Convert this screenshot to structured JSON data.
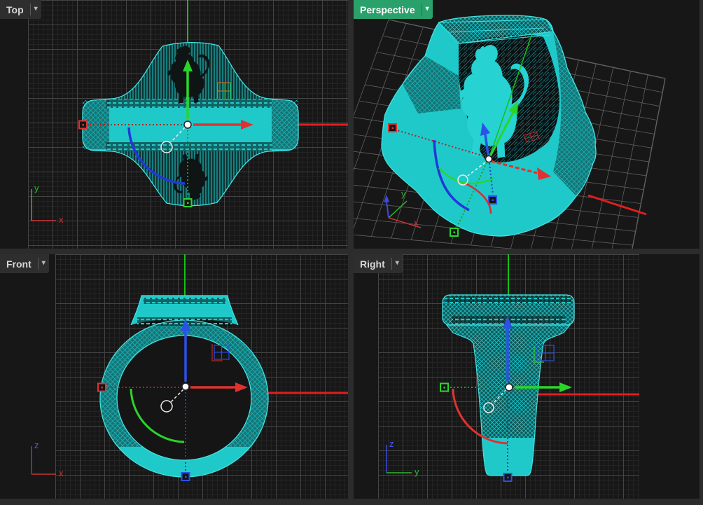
{
  "viewports": {
    "top": {
      "label": "Top",
      "active": false,
      "axis_gizmo": {
        "vertical_label": "y",
        "horizontal_label": "x"
      }
    },
    "perspective": {
      "label": "Perspective",
      "active": true,
      "axis_gizmo": {
        "vertical_label": "y",
        "horizontal_label": "x"
      }
    },
    "front": {
      "label": "Front",
      "active": false,
      "axis_gizmo": {
        "vertical_label": "z",
        "horizontal_label": "x"
      }
    },
    "right": {
      "label": "Right",
      "active": false,
      "axis_gizmo": {
        "vertical_label": "z",
        "horizontal_label": "y"
      }
    }
  },
  "chevron_glyph": "▾",
  "scene": {
    "model_name": "signet-ring-wireframe",
    "engraving": "lion-silhouette",
    "widgets": [
      "gumball-move-arrows",
      "gumball-rotate-arcs",
      "gumball-scale-handles",
      "gumball-plane-handle",
      "cplane-axis-gizmo",
      "world-axis-lines"
    ]
  },
  "colors": {
    "active_tab_green": "#2aa06b",
    "tab_background": "#2e2e2e",
    "tab_text": "#d6d6d6",
    "viewport_background": "#171717",
    "chrome_background": "#2c2c2c",
    "grid_minor": "#242424",
    "grid_major": "#444444",
    "perspective_grid": "#606060",
    "model_cyan": "#20c9c9",
    "gumball_x_red": "#e03131",
    "gumball_y_green": "#2ad52a",
    "gumball_z_blue": "#2b51e8",
    "axis_x_red": "#e01e1e",
    "axis_y_green": "#18c018",
    "axis_z_blue": "#3c4ae0"
  }
}
